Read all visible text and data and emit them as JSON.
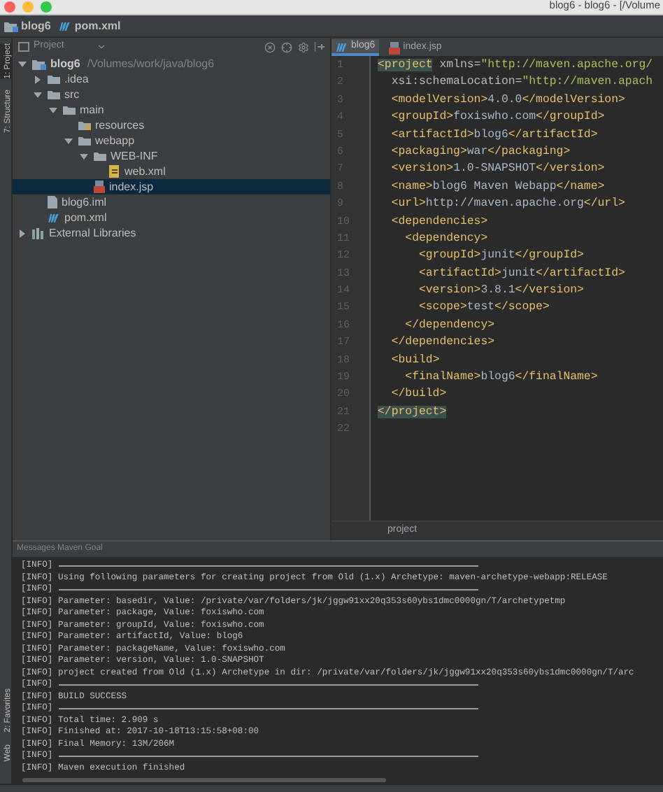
{
  "window": {
    "title": "blog6 - blog6 - [/Volume"
  },
  "breadcrumbs": [
    {
      "label": "blog6",
      "kind": "module"
    },
    {
      "label": "pom.xml",
      "kind": "maven"
    }
  ],
  "tool_strip": {
    "top": [
      {
        "label": "1: Project",
        "selected": true
      },
      {
        "label": "7: Structure",
        "selected": false
      }
    ],
    "bottom": [
      {
        "label": "2: Favorites",
        "selected": false
      },
      {
        "label": "Web",
        "selected": false
      }
    ]
  },
  "project_panel": {
    "title": "Project",
    "tree": [
      {
        "label": "blog6",
        "path": "/Volumes/work/java/blog6",
        "kind": "module",
        "expanded": true,
        "selected": false,
        "children": [
          {
            "label": ".idea",
            "kind": "folder",
            "expanded": false,
            "selected": false
          },
          {
            "label": "src",
            "kind": "folder",
            "expanded": true,
            "selected": false,
            "children": [
              {
                "label": "main",
                "kind": "folder",
                "expanded": true,
                "selected": false,
                "children": [
                  {
                    "label": "resources",
                    "kind": "resources",
                    "selected": false
                  },
                  {
                    "label": "webapp",
                    "kind": "folder",
                    "expanded": true,
                    "selected": false,
                    "children": [
                      {
                        "label": "WEB-INF",
                        "kind": "folder",
                        "expanded": true,
                        "selected": false,
                        "children": [
                          {
                            "label": "web.xml",
                            "kind": "xml",
                            "selected": false
                          }
                        ]
                      },
                      {
                        "label": "index.jsp",
                        "kind": "jsp",
                        "selected": true
                      }
                    ]
                  }
                ]
              }
            ]
          },
          {
            "label": "blog6.iml",
            "kind": "iml",
            "selected": false
          },
          {
            "label": "pom.xml",
            "kind": "maven",
            "selected": false
          }
        ]
      },
      {
        "label": "External Libraries",
        "kind": "libraries",
        "expanded": false,
        "selected": false
      }
    ]
  },
  "editor": {
    "tabs": [
      {
        "label": "blog6",
        "kind": "maven",
        "selected": true
      },
      {
        "label": "index.jsp",
        "kind": "jsp",
        "selected": false
      }
    ],
    "lines": [
      {
        "number": "1",
        "code": "<project xmlns=\"http://maven.apache.org/",
        "matched": true
      },
      {
        "number": "2",
        "code": "  xsi:schemaLocation=\"http://maven.apach",
        "matched": false
      },
      {
        "number": "3",
        "code": "  <modelVersion>4.0.0</modelVersion>",
        "matched": false
      },
      {
        "number": "4",
        "code": "  <groupId>foxiswho.com</groupId>",
        "matched": false
      },
      {
        "number": "5",
        "code": "  <artifactId>blog6</artifactId>",
        "matched": false
      },
      {
        "number": "6",
        "code": "  <packaging>war</packaging>",
        "matched": false
      },
      {
        "number": "7",
        "code": "  <version>1.0-SNAPSHOT</version>",
        "matched": false
      },
      {
        "number": "8",
        "code": "  <name>blog6 Maven Webapp</name>",
        "matched": false
      },
      {
        "number": "9",
        "code": "  <url>http://maven.apache.org</url>",
        "matched": false
      },
      {
        "number": "10",
        "code": "  <dependencies>",
        "matched": false
      },
      {
        "number": "11",
        "code": "    <dependency>",
        "matched": false
      },
      {
        "number": "12",
        "code": "      <groupId>junit</groupId>",
        "matched": false
      },
      {
        "number": "13",
        "code": "      <artifactId>junit</artifactId>",
        "matched": false
      },
      {
        "number": "14",
        "code": "      <version>3.8.1</version>",
        "matched": false
      },
      {
        "number": "15",
        "code": "      <scope>test</scope>",
        "matched": false
      },
      {
        "number": "16",
        "code": "    </dependency>",
        "matched": false
      },
      {
        "number": "17",
        "code": "  </dependencies>",
        "matched": false
      },
      {
        "number": "18",
        "code": "  <build>",
        "matched": false
      },
      {
        "number": "19",
        "code": "    <finalName>blog6</finalName>",
        "matched": false
      },
      {
        "number": "20",
        "code": "  </build>",
        "matched": false
      },
      {
        "number": "21",
        "code": "</project>",
        "matched": true
      },
      {
        "number": "22"
      }
    ],
    "breadcrumb": "project"
  },
  "messages": {
    "title": "Messages Maven Goal",
    "lines": [
      {
        "kind": "rule",
        "text": "[INFO]"
      },
      {
        "kind": "text",
        "text": "[INFO] Using following parameters for creating project from Old (1.x) Archetype: maven-archetype-webapp:RELEASE"
      },
      {
        "kind": "rule",
        "text": "[INFO]"
      },
      {
        "kind": "text",
        "text": "[INFO] Parameter: basedir, Value: /private/var/folders/jk/jggw91xx20q353s60ybs1dmc0000gn/T/archetypetmp"
      },
      {
        "kind": "text",
        "text": "[INFO] Parameter: package, Value: foxiswho.com"
      },
      {
        "kind": "text",
        "text": "[INFO] Parameter: groupId, Value: foxiswho.com"
      },
      {
        "kind": "text",
        "text": "[INFO] Parameter: artifactId, Value: blog6"
      },
      {
        "kind": "text",
        "text": "[INFO] Parameter: packageName, Value: foxiswho.com"
      },
      {
        "kind": "text",
        "text": "[INFO] Parameter: version, Value: 1.0-SNAPSHOT"
      },
      {
        "kind": "text",
        "text": "[INFO] project created from Old (1.x) Archetype in dir: /private/var/folders/jk/jggw91xx20q353s60ybs1dmc0000gn/T/arc"
      },
      {
        "kind": "rule",
        "text": "[INFO]"
      },
      {
        "kind": "text",
        "text": "[INFO] BUILD SUCCESS"
      },
      {
        "kind": "rule",
        "text": "[INFO]"
      },
      {
        "kind": "text",
        "text": "[INFO] Total time: 2.909 s"
      },
      {
        "kind": "text",
        "text": "[INFO] Finished at: 2017-10-18T13:15:58+08:00"
      },
      {
        "kind": "text",
        "text": "[INFO] Final Memory: 13M/206M"
      },
      {
        "kind": "rule",
        "text": "[INFO]"
      },
      {
        "kind": "text",
        "text": "[INFO] Maven execution finished"
      }
    ]
  }
}
